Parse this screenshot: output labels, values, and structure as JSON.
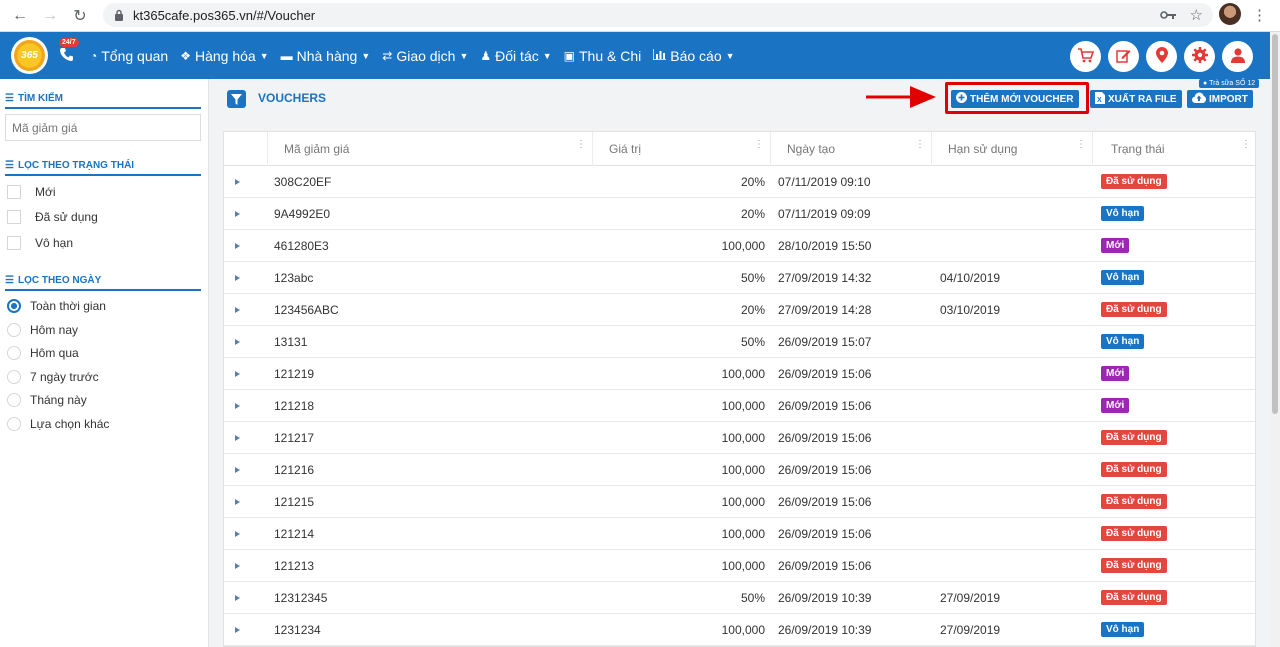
{
  "browser": {
    "url": "kt365cafe.pos365.vn/#/Voucher"
  },
  "navbar": {
    "logo_text": "365",
    "badge": "24/7",
    "items": [
      {
        "label": "Tổng quan",
        "icon": "dashboard-icon",
        "caret": false
      },
      {
        "label": "Hàng hóa",
        "icon": "cubes-icon",
        "caret": true
      },
      {
        "label": "Nhà hàng",
        "icon": "bed-icon",
        "caret": true
      },
      {
        "label": "Giao dịch",
        "icon": "exchange-icon",
        "caret": true
      },
      {
        "label": "Đối tác",
        "icon": "users-icon",
        "caret": true
      },
      {
        "label": "Thu & Chi",
        "icon": "money-icon",
        "caret": false
      },
      {
        "label": "Báo cáo",
        "icon": "bar-chart-icon",
        "caret": true
      }
    ],
    "branch": "Trà sữa SỐ 12"
  },
  "sidebar": {
    "search_title": "TÌM KIẾM",
    "search_placeholder": "Mã giảm giá",
    "status_title": "LỌC THEO TRẠNG THÁI",
    "status_filters": [
      "Mới",
      "Đã sử dụng",
      "Vô hạn"
    ],
    "date_title": "LỌC THEO NGÀY",
    "date_filters": [
      "Toàn thời gian",
      "Hôm nay",
      "Hôm qua",
      "7 ngày trước",
      "Tháng này",
      "Lựa chọn khác"
    ],
    "date_selected": "Toàn thời gian"
  },
  "header": {
    "title": "VOUCHERS",
    "add_button": "THÊM MỚI VOUCHER",
    "export_button": "XUẤT RA FILE",
    "import_button": "IMPORT"
  },
  "table": {
    "columns": [
      "Mã giảm giá",
      "Giá trị",
      "Ngày tạo",
      "Hạn sử dụng",
      "Trạng thái"
    ],
    "rows": [
      {
        "code": "308C20EF",
        "value": "20%",
        "created": "07/11/2019 09:10",
        "expiry": "",
        "status": "Đã sử dụng",
        "status_type": "used"
      },
      {
        "code": "9A4992E0",
        "value": "20%",
        "created": "07/11/2019 09:09",
        "expiry": "",
        "status": "Vô hạn",
        "status_type": "unlimited"
      },
      {
        "code": "461280E3",
        "value": "100,000",
        "created": "28/10/2019 15:50",
        "expiry": "",
        "status": "Mới",
        "status_type": "new"
      },
      {
        "code": "123abc",
        "value": "50%",
        "created": "27/09/2019 14:32",
        "expiry": "04/10/2019",
        "status": "Vô hạn",
        "status_type": "unlimited"
      },
      {
        "code": "123456ABC",
        "value": "20%",
        "created": "27/09/2019 14:28",
        "expiry": "03/10/2019",
        "status": "Đã sử dụng",
        "status_type": "used"
      },
      {
        "code": "13131",
        "value": "50%",
        "created": "26/09/2019 15:07",
        "expiry": "",
        "status": "Vô hạn",
        "status_type": "unlimited"
      },
      {
        "code": "121219",
        "value": "100,000",
        "created": "26/09/2019 15:06",
        "expiry": "",
        "status": "Mới",
        "status_type": "new"
      },
      {
        "code": "121218",
        "value": "100,000",
        "created": "26/09/2019 15:06",
        "expiry": "",
        "status": "Mới",
        "status_type": "new"
      },
      {
        "code": "121217",
        "value": "100,000",
        "created": "26/09/2019 15:06",
        "expiry": "",
        "status": "Đã sử dụng",
        "status_type": "used"
      },
      {
        "code": "121216",
        "value": "100,000",
        "created": "26/09/2019 15:06",
        "expiry": "",
        "status": "Đã sử dụng",
        "status_type": "used"
      },
      {
        "code": "121215",
        "value": "100,000",
        "created": "26/09/2019 15:06",
        "expiry": "",
        "status": "Đã sử dụng",
        "status_type": "used"
      },
      {
        "code": "121214",
        "value": "100,000",
        "created": "26/09/2019 15:06",
        "expiry": "",
        "status": "Đã sử dụng",
        "status_type": "used"
      },
      {
        "code": "121213",
        "value": "100,000",
        "created": "26/09/2019 15:06",
        "expiry": "",
        "status": "Đã sử dụng",
        "status_type": "used"
      },
      {
        "code": "12312345",
        "value": "50%",
        "created": "26/09/2019 10:39",
        "expiry": "27/09/2019",
        "status": "Đã sử dụng",
        "status_type": "used"
      },
      {
        "code": "1231234",
        "value": "100,000",
        "created": "26/09/2019 10:39",
        "expiry": "27/09/2019",
        "status": "Vô hạn",
        "status_type": "unlimited"
      }
    ]
  },
  "colors": {
    "primary": "#1a73c3",
    "status_used": "#e2463f",
    "status_unlimited": "#1a73c3",
    "status_new": "#9c27b0",
    "annotation": "#e00000"
  }
}
